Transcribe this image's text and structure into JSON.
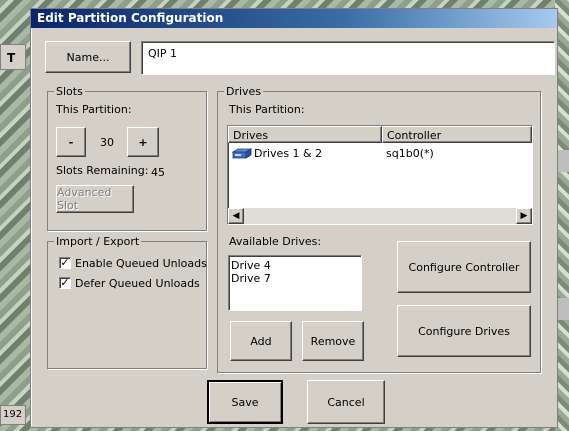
{
  "dialog": {
    "title": "Edit Partition Configuration"
  },
  "background": {
    "tab_label": "T",
    "counter_text": "192"
  },
  "name": {
    "button_label": "Name...",
    "value": "QIP 1"
  },
  "slots": {
    "group_label": "Slots",
    "this_partition_label": "This Partition:",
    "decrement_label": "-",
    "value": "30",
    "increment_label": "+",
    "remaining_label": "Slots Remaining:",
    "remaining_value": "45",
    "advanced_button": "Advanced Slot"
  },
  "import_export": {
    "group_label": "Import / Export",
    "enable_queued_unloads": {
      "label": "Enable Queued Unloads",
      "checked": true
    },
    "defer_queued_unloads": {
      "label": "Defer Queued Unloads",
      "checked": true
    }
  },
  "drives": {
    "group_label": "Drives",
    "this_partition_label": "This Partition:",
    "columns": [
      "Drives",
      "Controller"
    ],
    "rows": [
      {
        "drives": "Drives 1 & 2",
        "controller": "sq1b0(*)",
        "icon": "tape-drive-icon"
      }
    ],
    "available_label": "Available Drives:",
    "available": [
      "Drive 4",
      "Drive 7"
    ],
    "add_button": "Add",
    "remove_button": "Remove",
    "configure_controller_button": "Configure Controller",
    "configure_drives_button": "Configure Drives"
  },
  "footer": {
    "save_button": "Save",
    "cancel_button": "Cancel"
  }
}
